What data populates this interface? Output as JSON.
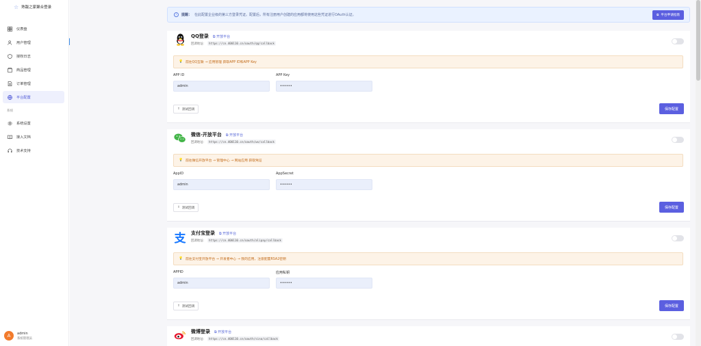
{
  "sidebar": {
    "brand": "熟跋之家聚合登录",
    "items": [
      {
        "label": "仪表盘",
        "icon": "dashboard-icon"
      },
      {
        "label": "用户管理",
        "icon": "user-icon"
      },
      {
        "label": "授权日志",
        "icon": "shield-icon"
      },
      {
        "label": "商品管理",
        "icon": "box-icon"
      },
      {
        "label": "订单管理",
        "icon": "document-icon"
      },
      {
        "label": "平台配置",
        "icon": "globe-icon",
        "active": true
      }
    ],
    "section": "系统",
    "system_items": [
      {
        "label": "系统设置",
        "icon": "gear-icon"
      },
      {
        "label": "接入文档",
        "icon": "book-icon"
      },
      {
        "label": "技术支持",
        "icon": "headset-icon"
      }
    ],
    "user": {
      "name": "admin",
      "role": "系统管理员",
      "avatar_letter": "A"
    }
  },
  "notice": {
    "prefix": "提醒：",
    "text": "在此配置企业级的第三方登录凭证。配置后，所有注册用户创建的应用都将使用这些凭证进行OAuth认证。",
    "button": "平台申请指南"
  },
  "platforms": [
    {
      "name": "QQ登录",
      "link": "开放平台",
      "callback_label": "回调地址:",
      "callback": "https://cn.400110.cn/oauth/qq/callback",
      "tip": "前往QQ互联 → 应用管理 获取APP ID和APP Key",
      "field1_label": "APP ID",
      "field1_value": "admin",
      "field2_label": "APP Key",
      "field2_value": "••••••",
      "test": "测试回调",
      "save": "保存配置"
    },
    {
      "name": "微信-开放平台",
      "link": "开放平台",
      "callback_label": "回调地址:",
      "callback": "https://cn.400110.cn/oauth/wx/callback",
      "tip": "前往微信开放平台 → 管理中心 → 网站应用 获取凭证",
      "field1_label": "AppID",
      "field1_value": "admin",
      "field2_label": "AppSecret",
      "field2_value": "••••••",
      "test": "测试回调",
      "save": "保存配置"
    },
    {
      "name": "支付宝登录",
      "link": "开放平台",
      "callback_label": "回调地址:",
      "callback": "https://cn.400110.cn/oauth/alipay/callback",
      "tip": "前往支付宝开放平台 → 开发者中心 → 我的应用，注意配置RSA2密钥",
      "field1_label": "APPID",
      "field1_value": "admin",
      "field2_label": "应用私钥",
      "field2_value": "••••••",
      "test": "测试回调",
      "save": "保存配置"
    },
    {
      "name": "微博登录",
      "link": "开放平台",
      "callback_label": "回调地址:",
      "callback": "https://cn.400110.cn/oauth/sina/callback"
    }
  ],
  "colors": {
    "accent": "#5b5fe0",
    "tip_bg": "#fdf3e7",
    "tip_text": "#c26a17",
    "notice_bg": "#eaf2ff"
  }
}
